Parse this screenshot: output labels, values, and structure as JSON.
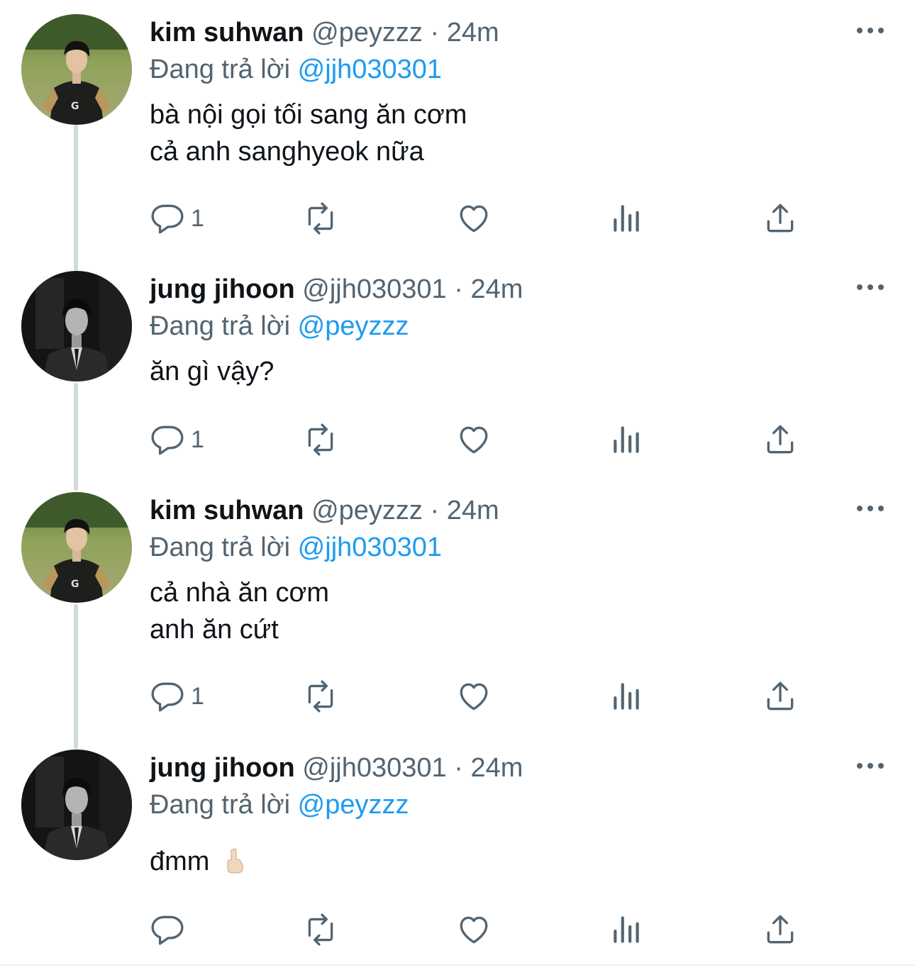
{
  "colors": {
    "text_primary": "#0f1419",
    "text_secondary": "#536471",
    "link": "#1d9bf0",
    "thread_line": "#cfd9de"
  },
  "tweets": [
    {
      "name": "kim suhwan",
      "handle": "@peyzzz",
      "dot": "·",
      "time": "24m",
      "reply_prefix": "Đang trả lời",
      "reply_to": "@jjh030301",
      "lines": [
        "bà nội gọi tối sang ăn cơm",
        "cả anh sanghyeok nữa"
      ],
      "reply_count": "1",
      "avatar": "green-field-avatar"
    },
    {
      "name": "jung jihoon",
      "handle": "@jjh030301",
      "dot": "·",
      "time": "24m",
      "reply_prefix": "Đang trả lời",
      "reply_to": "@peyzzz",
      "lines": [
        "ăn gì vậy?"
      ],
      "reply_count": "1",
      "avatar": "dark-suit-avatar"
    },
    {
      "name": "kim suhwan",
      "handle": "@peyzzz",
      "dot": "·",
      "time": "24m",
      "reply_prefix": "Đang trả lời",
      "reply_to": "@jjh030301",
      "lines": [
        "cả nhà ăn cơm",
        "anh ăn cứt"
      ],
      "reply_count": "1",
      "avatar": "green-field-avatar"
    },
    {
      "name": "jung jihoon",
      "handle": "@jjh030301",
      "dot": "·",
      "time": "24m",
      "reply_prefix": "Đang trả lời",
      "reply_to": "@peyzzz",
      "lines": [
        "đmm"
      ],
      "reply_count": "",
      "emoji": "middle-finger-emoji",
      "avatar": "dark-suit-avatar"
    }
  ],
  "icons": {
    "reply": "reply-icon",
    "retweet": "retweet-icon",
    "like": "heart-icon",
    "views": "analytics-icon",
    "share": "share-icon",
    "more": "more-icon"
  }
}
